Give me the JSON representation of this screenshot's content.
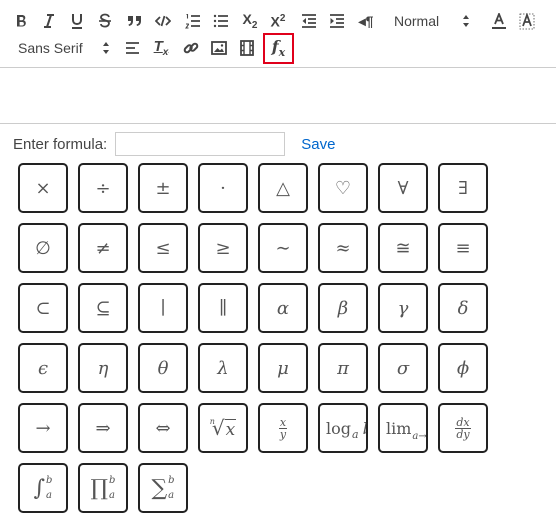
{
  "toolbar": {
    "header_value": "Normal",
    "font_value": "Sans Serif",
    "paragraph_glyph": "¶",
    "subscript_label": "X",
    "subscript_mark": "2",
    "superscript_label": "X",
    "superscript_mark": "2",
    "formula_label": "f",
    "formula_sub": "x",
    "clean_label": "T",
    "clean_sub": "x",
    "icons": [
      "bold-icon",
      "italic-icon",
      "underline-icon",
      "strike-icon",
      "blockquote-icon",
      "code-block-icon",
      "ordered-list-icon",
      "bullet-list-icon",
      "subscript-icon",
      "superscript-icon",
      "outdent-icon",
      "indent-icon",
      "rtl-direction-icon",
      "text-color-icon",
      "background-color-icon",
      "align-icon",
      "clean-format-icon",
      "link-icon",
      "image-icon",
      "video-icon",
      "formula-icon"
    ],
    "highlight_color": "#e0001b"
  },
  "formula": {
    "label": "Enter formula:",
    "value": "",
    "save_label": "Save"
  },
  "symbols": [
    {
      "id": "times",
      "text": "×"
    },
    {
      "id": "divide",
      "text": "÷"
    },
    {
      "id": "plus-minus",
      "text": "±"
    },
    {
      "id": "center-dot",
      "text": "·"
    },
    {
      "id": "triangle",
      "text": "△"
    },
    {
      "id": "heart",
      "text": "♡"
    },
    {
      "id": "for-all",
      "text": "∀"
    },
    {
      "id": "exists",
      "text": "∃"
    },
    {
      "id": "empty-set",
      "text": "∅"
    },
    {
      "id": "not-equal",
      "text": "≠"
    },
    {
      "id": "less-equal",
      "text": "≤"
    },
    {
      "id": "greater-equal",
      "text": "≥"
    },
    {
      "id": "similar",
      "text": "∼"
    },
    {
      "id": "approx",
      "text": "≈"
    },
    {
      "id": "congruent",
      "text": "≅"
    },
    {
      "id": "equivalent",
      "text": "≡"
    },
    {
      "id": "subset",
      "text": "⊂"
    },
    {
      "id": "subset-equal",
      "text": "⊆"
    },
    {
      "id": "divides",
      "text": "∣"
    },
    {
      "id": "parallel",
      "text": "∥"
    },
    {
      "id": "alpha",
      "text": "α"
    },
    {
      "id": "beta",
      "text": "β"
    },
    {
      "id": "gamma",
      "text": "γ"
    },
    {
      "id": "delta",
      "text": "δ"
    },
    {
      "id": "epsilon",
      "text": "ϵ"
    },
    {
      "id": "eta",
      "text": "η"
    },
    {
      "id": "theta",
      "text": "θ"
    },
    {
      "id": "lambda",
      "text": "λ"
    },
    {
      "id": "mu",
      "text": "μ"
    },
    {
      "id": "pi",
      "text": "π"
    },
    {
      "id": "sigma",
      "text": "σ"
    },
    {
      "id": "phi",
      "text": "ϕ"
    },
    {
      "id": "right-arrow",
      "text": "→"
    },
    {
      "id": "implies",
      "text": "⇒"
    },
    {
      "id": "iff",
      "text": "⇔"
    },
    {
      "id": "nth-root",
      "text": "√"
    },
    {
      "id": "fraction",
      "text": "x/y"
    },
    {
      "id": "logarithm",
      "text": "log"
    },
    {
      "id": "limit",
      "text": "lim"
    },
    {
      "id": "derivative",
      "text": "dx/dy"
    },
    {
      "id": "integral",
      "text": "∫"
    },
    {
      "id": "product",
      "text": "∏"
    },
    {
      "id": "summation",
      "text": "∑"
    }
  ],
  "tex": {
    "root_index": "n",
    "root_body": "x",
    "frac_num": "x",
    "frac_den": "y",
    "log_base": "a",
    "log_arg": "b",
    "lim_sub": "a→b",
    "deriv_num": "dx",
    "deriv_den": "dy",
    "upper": "b",
    "lower": "a"
  }
}
